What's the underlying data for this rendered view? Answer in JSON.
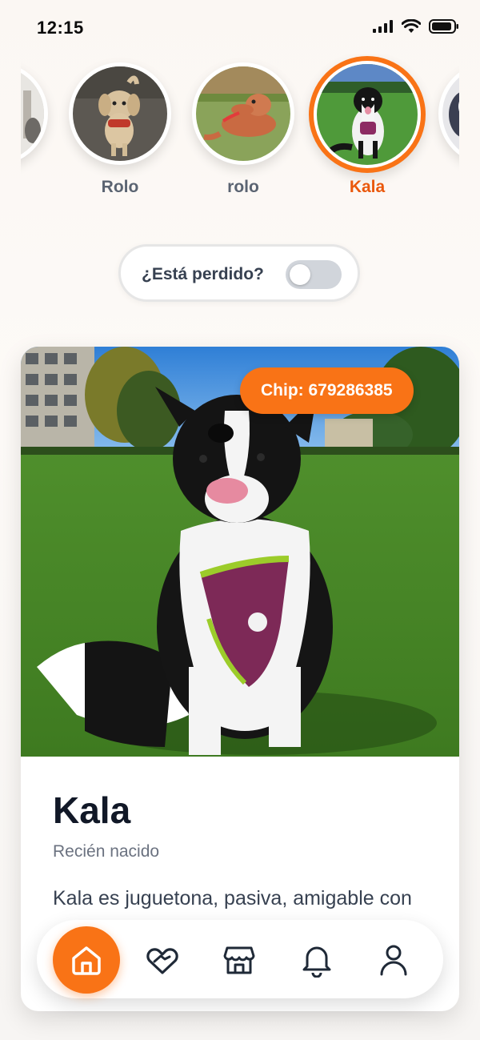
{
  "status_bar": {
    "time": "12:15"
  },
  "pets": [
    {
      "name": "",
      "active": false
    },
    {
      "name": "Rolo",
      "active": false
    },
    {
      "name": "rolo",
      "active": false
    },
    {
      "name": "Kala",
      "active": true
    },
    {
      "name": "",
      "active": false
    }
  ],
  "lost_toggle": {
    "label": "¿Está perdido?",
    "value": false
  },
  "card": {
    "chip_label": "Chip: 679286385",
    "name": "Kala",
    "age": "Recién nacido",
    "description": "Kala es juguetona, pasiva, amigable con"
  },
  "nav": {
    "items": [
      "home-icon",
      "heart-hands-icon",
      "store-icon",
      "bell-icon",
      "user-icon"
    ],
    "active": "home-icon"
  },
  "colors": {
    "accent": "#f97316",
    "accent_text": "#ea580c",
    "muted": "#5b6472"
  }
}
